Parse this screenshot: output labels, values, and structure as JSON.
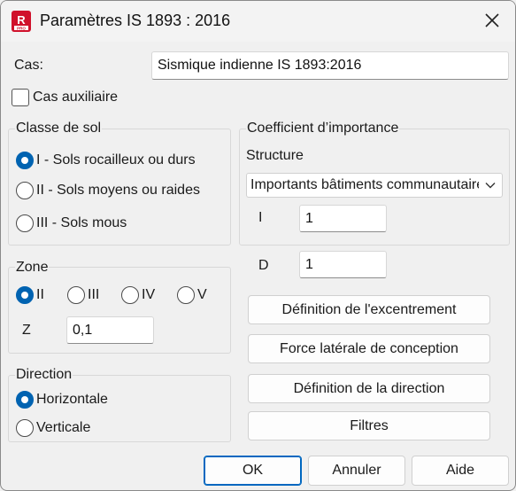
{
  "window": {
    "title": "Paramètres IS 1893 : 2016"
  },
  "icons": {
    "app": "revit-app-icon",
    "close": "close-icon",
    "chevron": "chevron-down-icon"
  },
  "colors": {
    "accent": "#0063b1"
  },
  "cas": {
    "label": "Cas:",
    "value": "Sismique indienne IS 1893:2016"
  },
  "cas_auxiliaire": {
    "label": "Cas auxiliaire",
    "checked": false
  },
  "classe_de_sol": {
    "title": "Classe de sol",
    "options": [
      {
        "label": "I - Sols rocailleux ou durs",
        "selected": true
      },
      {
        "label": "II - Sols moyens ou raides",
        "selected": false
      },
      {
        "label": "III - Sols mous",
        "selected": false
      }
    ]
  },
  "zone": {
    "title": "Zone",
    "options": [
      {
        "label": "II",
        "selected": true
      },
      {
        "label": "III",
        "selected": false
      },
      {
        "label": "IV",
        "selected": false
      },
      {
        "label": "V",
        "selected": false
      }
    ],
    "z_label": "Z",
    "z_value": "0,1"
  },
  "direction": {
    "title": "Direction",
    "options": [
      {
        "label": "Horizontale",
        "selected": true
      },
      {
        "label": "Verticale",
        "selected": false
      }
    ]
  },
  "importance": {
    "title": "Coefficient d’importance",
    "structure_label": "Structure",
    "structure_value": "Importants bâtiments communautaires",
    "i_label": "I",
    "i_value": "1"
  },
  "d": {
    "label": "D",
    "value": "1"
  },
  "actions": {
    "excentrement": "Définition de l'excentrement",
    "force_laterale": "Force latérale de conception",
    "direction": "Définition de la direction",
    "filtres": "Filtres"
  },
  "footer": {
    "ok": "OK",
    "annuler": "Annuler",
    "aide": "Aide"
  }
}
